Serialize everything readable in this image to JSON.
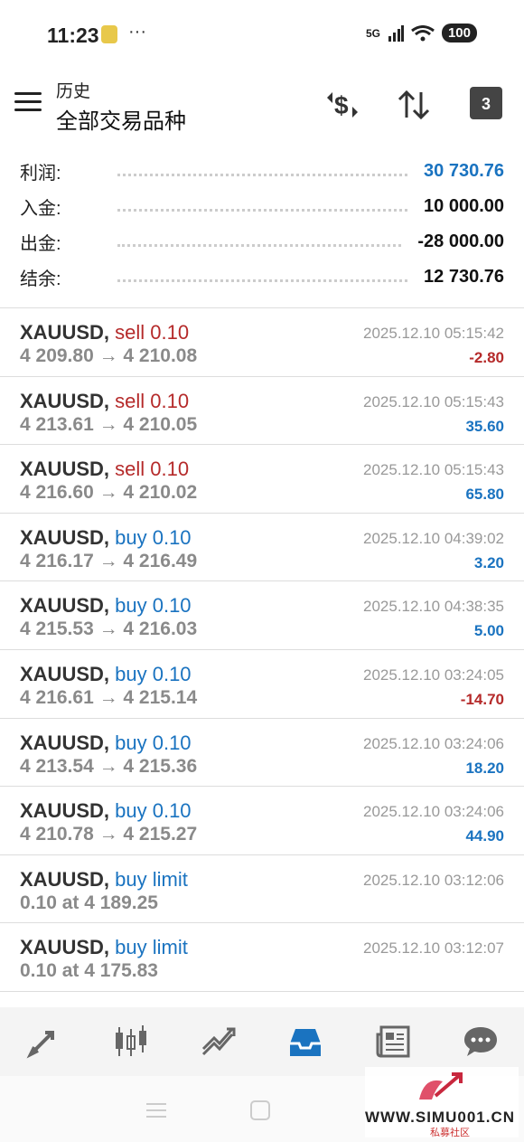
{
  "status": {
    "time": "11:23",
    "dots": "···",
    "network": "5G",
    "battery": "100"
  },
  "header": {
    "subtitle": "历史",
    "title": "全部交易品种",
    "calendar_day": "3"
  },
  "summary": [
    {
      "label": "利润:",
      "value": "30 730.76",
      "color": "#1a73c0"
    },
    {
      "label": "入金:",
      "value": "10 000.00",
      "color": "#111111"
    },
    {
      "label": "出金:",
      "value": "-28 000.00",
      "color": "#111111"
    },
    {
      "label": "结余:",
      "value": "12 730.76",
      "color": "#111111"
    }
  ],
  "deals": [
    {
      "symbol": "XAUUSD,",
      "side": "sell 0.10",
      "type": "sell",
      "prices": "4 209.80 → 4 210.08",
      "time": "2025.12.10 05:15:42",
      "profit": "-2.80"
    },
    {
      "symbol": "XAUUSD,",
      "side": "sell 0.10",
      "type": "sell",
      "prices": "4 213.61 → 4 210.05",
      "time": "2025.12.10 05:15:43",
      "profit": "35.60"
    },
    {
      "symbol": "XAUUSD,",
      "side": "sell 0.10",
      "type": "sell",
      "prices": "4 216.60 → 4 210.02",
      "time": "2025.12.10 05:15:43",
      "profit": "65.80"
    },
    {
      "symbol": "XAUUSD,",
      "side": "buy 0.10",
      "type": "buy",
      "prices": "4 216.17 → 4 216.49",
      "time": "2025.12.10 04:39:02",
      "profit": "3.20"
    },
    {
      "symbol": "XAUUSD,",
      "side": "buy 0.10",
      "type": "buy",
      "prices": "4 215.53 → 4 216.03",
      "time": "2025.12.10 04:38:35",
      "profit": "5.00"
    },
    {
      "symbol": "XAUUSD,",
      "side": "buy 0.10",
      "type": "buy",
      "prices": "4 216.61 → 4 215.14",
      "time": "2025.12.10 03:24:05",
      "profit": "-14.70"
    },
    {
      "symbol": "XAUUSD,",
      "side": "buy 0.10",
      "type": "buy",
      "prices": "4 213.54 → 4 215.36",
      "time": "2025.12.10 03:24:06",
      "profit": "18.20"
    },
    {
      "symbol": "XAUUSD,",
      "side": "buy 0.10",
      "type": "buy",
      "prices": "4 210.78 → 4 215.27",
      "time": "2025.12.10 03:24:06",
      "profit": "44.90"
    },
    {
      "symbol": "XAUUSD,",
      "side": "buy limit",
      "type": "buy",
      "prices": "0.10 at 4 189.25",
      "time": "2025.12.10 03:12:06",
      "profit": ""
    },
    {
      "symbol": "XAUUSD,",
      "side": "buy limit",
      "type": "buy",
      "prices": "0.10 at 4 175.83",
      "time": "2025.12.10 03:12:07",
      "profit": ""
    }
  ],
  "nav": [
    {
      "name": "quotes-icon",
      "active": false
    },
    {
      "name": "chart-icon",
      "active": false
    },
    {
      "name": "trade-icon",
      "active": false
    },
    {
      "name": "history-icon",
      "active": true
    },
    {
      "name": "news-icon",
      "active": false
    },
    {
      "name": "messages-icon",
      "active": false
    }
  ],
  "watermark": {
    "text": "WWW.SIMU001.CN",
    "sub": "私募社区"
  }
}
